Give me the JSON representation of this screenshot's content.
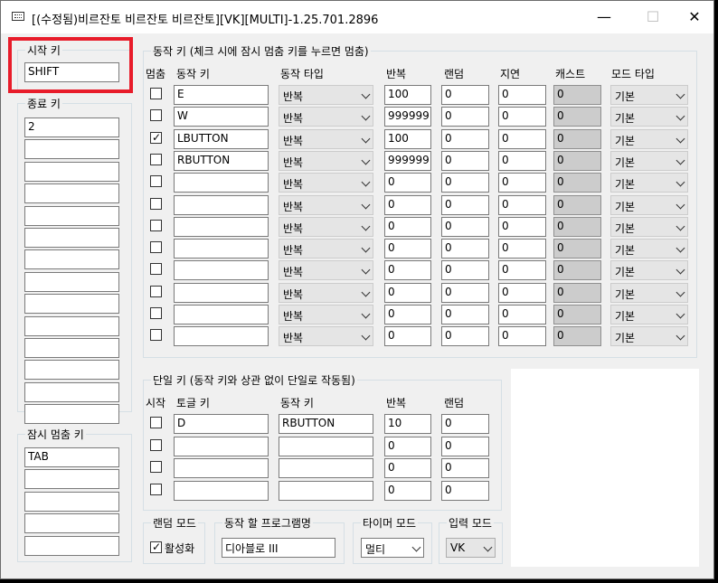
{
  "window": {
    "title": "[(수정됨)비르잔토 비르잔토 비르잔토][VK][MULTI]-1.25.701.2896",
    "minimize": "—",
    "maximize": "☐",
    "close": "✕"
  },
  "start_key": {
    "label": "시작 키",
    "value": "SHIFT"
  },
  "end_key": {
    "label": "종료 키",
    "values": [
      "2",
      "",
      "",
      "",
      "",
      "",
      "",
      "",
      "",
      "",
      "",
      "",
      "",
      ""
    ]
  },
  "pause_key": {
    "label": "잠시 멈춤 키",
    "values": [
      "TAB",
      "",
      "",
      "",
      ""
    ]
  },
  "action_keys": {
    "label": "동작 키 (체크 시에 잠시 멈춤 키를 누르면 멈춤)",
    "headers": {
      "stop": "멈춤",
      "key": "동작 키",
      "type": "동작 타입",
      "repeat": "반복",
      "random": "랜덤",
      "delay": "지연",
      "cast": "캐스트",
      "mode": "모드 타입"
    },
    "rows": [
      {
        "checked": false,
        "key": "E",
        "type": "반복",
        "repeat": "100",
        "random": "0",
        "delay": "0",
        "cast": "0",
        "mode": "기본"
      },
      {
        "checked": false,
        "key": "W",
        "type": "반복",
        "repeat": "999999",
        "random": "0",
        "delay": "0",
        "cast": "0",
        "mode": "기본"
      },
      {
        "checked": true,
        "key": "LBUTTON",
        "type": "반복",
        "repeat": "100",
        "random": "0",
        "delay": "0",
        "cast": "0",
        "mode": "기본"
      },
      {
        "checked": false,
        "key": "RBUTTON",
        "type": "반복",
        "repeat": "999999",
        "random": "0",
        "delay": "0",
        "cast": "0",
        "mode": "기본"
      },
      {
        "checked": false,
        "key": "",
        "type": "반복",
        "repeat": "0",
        "random": "0",
        "delay": "0",
        "cast": "0",
        "mode": "기본"
      },
      {
        "checked": false,
        "key": "",
        "type": "반복",
        "repeat": "0",
        "random": "0",
        "delay": "0",
        "cast": "0",
        "mode": "기본"
      },
      {
        "checked": false,
        "key": "",
        "type": "반복",
        "repeat": "0",
        "random": "0",
        "delay": "0",
        "cast": "0",
        "mode": "기본"
      },
      {
        "checked": false,
        "key": "",
        "type": "반복",
        "repeat": "0",
        "random": "0",
        "delay": "0",
        "cast": "0",
        "mode": "기본"
      },
      {
        "checked": false,
        "key": "",
        "type": "반복",
        "repeat": "0",
        "random": "0",
        "delay": "0",
        "cast": "0",
        "mode": "기본"
      },
      {
        "checked": false,
        "key": "",
        "type": "반복",
        "repeat": "0",
        "random": "0",
        "delay": "0",
        "cast": "0",
        "mode": "기본"
      },
      {
        "checked": false,
        "key": "",
        "type": "반복",
        "repeat": "0",
        "random": "0",
        "delay": "0",
        "cast": "0",
        "mode": "기본"
      },
      {
        "checked": false,
        "key": "",
        "type": "반복",
        "repeat": "0",
        "random": "0",
        "delay": "0",
        "cast": "0",
        "mode": "기본"
      }
    ]
  },
  "single_keys": {
    "label": "단일 키 (동작 키와 상관 없이 단일로 작동됨)",
    "headers": {
      "start": "시작",
      "toggle": "토글 키",
      "key": "동작 키",
      "repeat": "반복",
      "random": "랜덤"
    },
    "rows": [
      {
        "checked": false,
        "toggle": "D",
        "key": "RBUTTON",
        "repeat": "10",
        "random": "0"
      },
      {
        "checked": false,
        "toggle": "",
        "key": "",
        "repeat": "0",
        "random": "0"
      },
      {
        "checked": false,
        "toggle": "",
        "key": "",
        "repeat": "0",
        "random": "0"
      },
      {
        "checked": false,
        "toggle": "",
        "key": "",
        "repeat": "0",
        "random": "0"
      }
    ]
  },
  "random_mode": {
    "label": "랜덤 모드",
    "checkbox_label": "활성화",
    "checked": true
  },
  "program": {
    "label": "동작 할 프로그램명",
    "value": "디아블로 III"
  },
  "timer_mode": {
    "label": "타이머 모드",
    "value": "멀티"
  },
  "input_mode": {
    "label": "입력 모드",
    "value": "VK"
  },
  "colors": {
    "highlight": "#e81c2a",
    "window_bg": "#f0f0f0"
  }
}
